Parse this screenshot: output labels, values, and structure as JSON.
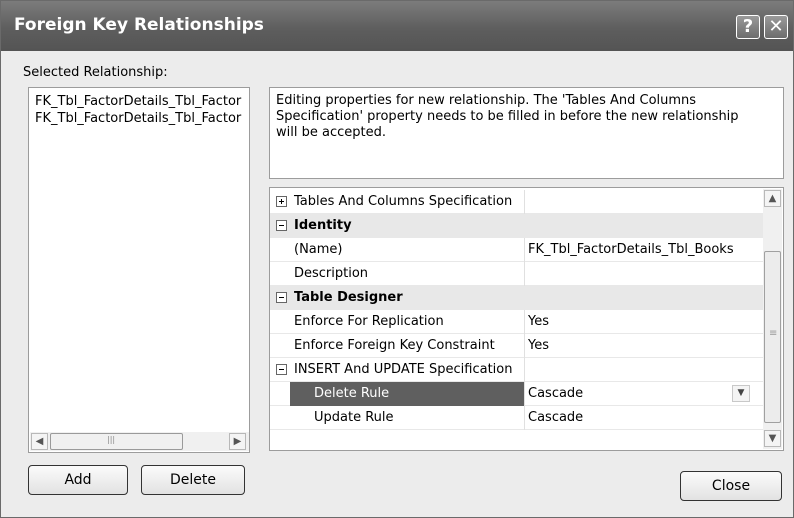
{
  "window": {
    "title": "Foreign Key Relationships",
    "help_glyph": "?",
    "close_glyph": "✕"
  },
  "left": {
    "label": "Selected Relationship:",
    "items": [
      "FK_Tbl_FactorDetails_Tbl_Factor",
      "FK_Tbl_FactorDetails_Tbl_Factor"
    ]
  },
  "description": "Editing properties for new relationship.  The 'Tables And Columns Specification' property needs to be filled in before the new relationship will be accepted.",
  "properties": {
    "rows": [
      {
        "expander": "plus",
        "name": "Tables And Columns Specification",
        "value": ""
      },
      {
        "expander": "minus",
        "name": "Identity",
        "category": true
      },
      {
        "name": "(Name)",
        "value": "FK_Tbl_FactorDetails_Tbl_Books"
      },
      {
        "name": "Description",
        "value": ""
      },
      {
        "expander": "minus",
        "name": "Table Designer",
        "category": true
      },
      {
        "name": "Enforce For Replication",
        "value": "Yes"
      },
      {
        "name": "Enforce Foreign Key Constraint",
        "value": "Yes"
      },
      {
        "expander": "minus",
        "name": "INSERT And UPDATE Specification",
        "value": ""
      },
      {
        "name": "Delete Rule",
        "value": "Cascade",
        "selected": true,
        "indent": true
      },
      {
        "name": "Update Rule",
        "value": "Cascade",
        "indent": true
      }
    ]
  },
  "buttons": {
    "add": "Add",
    "delete": "Delete",
    "close": "Close"
  },
  "glyphs": {
    "scroll_left": "◀",
    "scroll_right": "▶",
    "scroll_up": "▲",
    "scroll_down": "▼",
    "dropdown": "▼",
    "grip_h": "|||",
    "grip_v": "≡"
  }
}
